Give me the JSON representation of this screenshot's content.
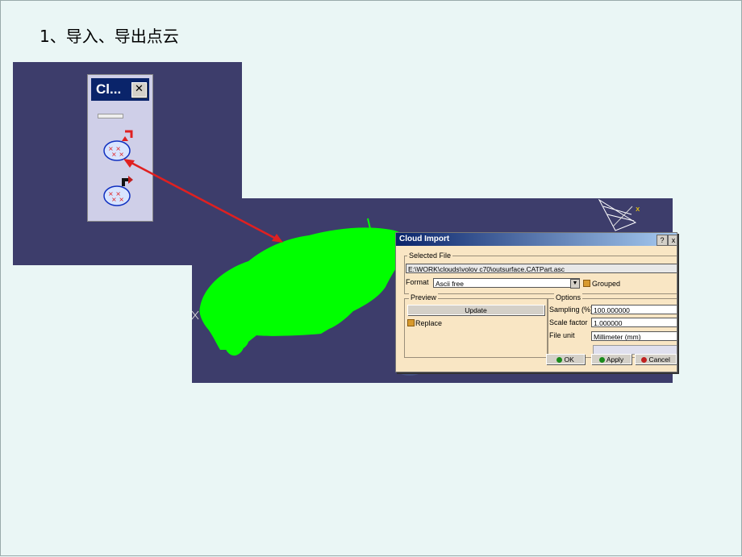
{
  "slide_title": "1、导入、导出点云",
  "toolbar": {
    "title": "Cl...",
    "close_glyph": "✕",
    "buttons": [
      {
        "icon": "cloud-import-icon"
      },
      {
        "icon": "cloud-export-icon"
      }
    ]
  },
  "viewport": {
    "axis_label": "x"
  },
  "dialog": {
    "title": "Cloud Import",
    "help": "?",
    "close": "x",
    "selected_file_label": "Selected File",
    "file_path": "E:\\WORK\\clouds\\volov c70\\outsurface.CATPart.asc",
    "format_label": "Format",
    "format_value": "Ascii free",
    "grouped_label": "Grouped",
    "preview_label": "Preview",
    "update_button": "Update",
    "replace_label": "Replace",
    "options_label": "Options",
    "sampling_label": "Sampling (%)",
    "sampling_value": "100.000000",
    "scale_label": "Scale factor",
    "scale_value": "1.000000",
    "unit_label": "File unit",
    "unit_value": "Millimeter (mm)",
    "ok_button": "OK",
    "apply_button": "Apply",
    "cancel_button": "Cancel"
  },
  "colors": {
    "background": "#3d3d6b",
    "car": "#00ff00",
    "arrow": "#e02020",
    "dialog": "#f9e6c4"
  }
}
